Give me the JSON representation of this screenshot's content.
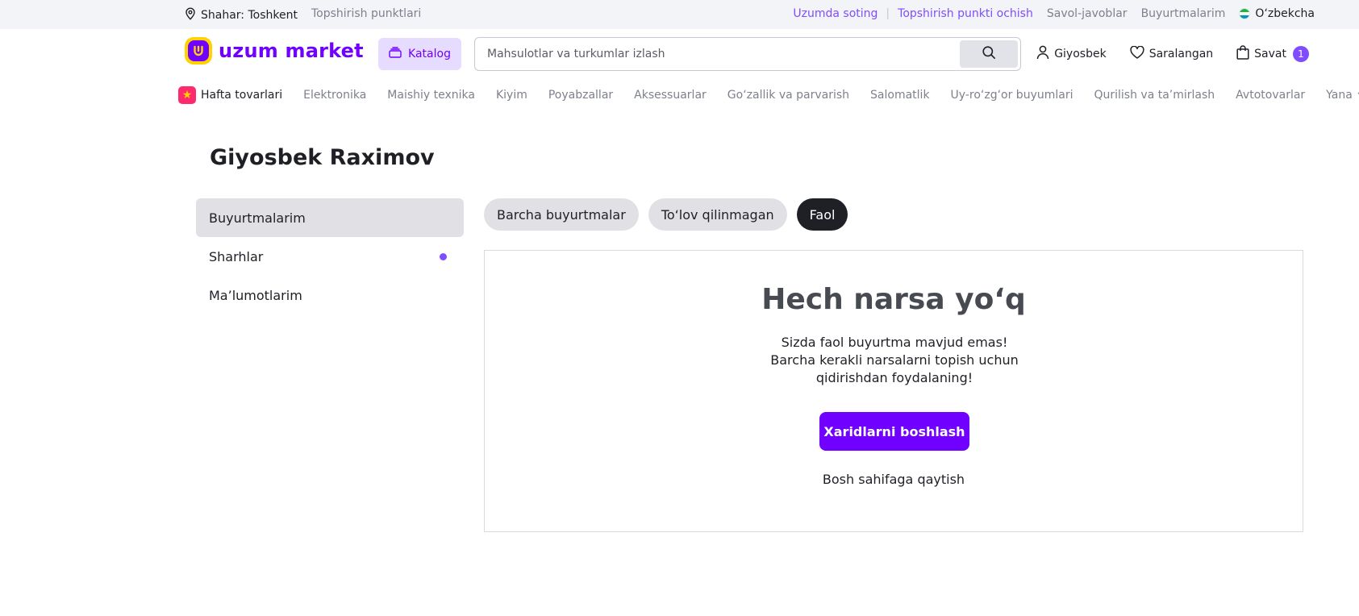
{
  "topbar": {
    "city_label": "Shahar: Toshkent",
    "pickup_points": "Topshirish punktlari",
    "sell_link": "Uzumda soting",
    "open_pickup_link": "Topshirish punkti ochish",
    "faq_link": "Savol-javoblar",
    "orders_link": "Buyurtmalarim",
    "language": "O‘zbekcha"
  },
  "header": {
    "logo_text": "uzum market",
    "catalog_label": "Katalog",
    "search_placeholder": "Mahsulotlar va turkumlar izlash",
    "user_label": "Giyosbek",
    "favorites_label": "Saralangan",
    "cart_label": "Savat",
    "cart_count": "1"
  },
  "categories": {
    "featured": "Hafta tovarlari",
    "items": [
      "Elektronika",
      "Maishiy texnika",
      "Kiyim",
      "Poyabzallar",
      "Aksessuarlar",
      "Go‘zallik va parvarish",
      "Salomatlik",
      "Uy-ro‘zg‘or buyumlari",
      "Qurilish va ta’mirlash",
      "Avtotovarlar"
    ],
    "more_label": "Yana"
  },
  "page": {
    "title": "Giyosbek Raximov"
  },
  "sidebar": {
    "items": [
      {
        "label": "Buyurtmalarim",
        "active": true
      },
      {
        "label": "Sharhlar",
        "has_dot": true
      },
      {
        "label": "Ma’lumotlarim"
      }
    ]
  },
  "tabs": [
    {
      "label": "Barcha buyurtmalar"
    },
    {
      "label": "To‘lov qilinmagan"
    },
    {
      "label": "Faol",
      "active": true
    }
  ],
  "empty_state": {
    "title": "Hech narsa yo‘q",
    "line1": "Sizda faol buyurtma mavjud emas!",
    "line2": "Barcha kerakli narsalarni topish uchun qidirishdan foydalaning!",
    "button_label": "Xaridlarni boshlash",
    "home_link": "Bosh sahifaga qaytish"
  },
  "colors": {
    "brand_purple": "#7000ff",
    "accent_purple": "#7f4dff",
    "brand_yellow": "#ffd200",
    "dark": "#1f2026"
  }
}
